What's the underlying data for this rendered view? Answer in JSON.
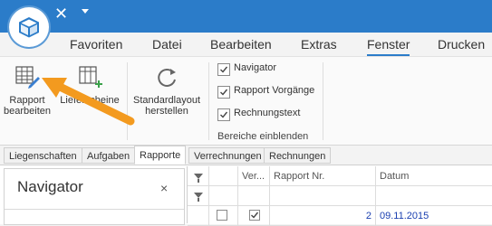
{
  "menu": [
    "Favoriten",
    "Datei",
    "Bearbeiten",
    "Extras",
    "Fenster",
    "Drucken"
  ],
  "active_menu_index": 4,
  "ribbon": {
    "rapport_bearbeiten": [
      "Rapport",
      "bearbeiten"
    ],
    "lieferscheine_partial": "Lieferscheine",
    "standardlayout": [
      "Standardlayout",
      "herstellen"
    ],
    "checkboxes": [
      {
        "label": "Navigator",
        "checked": true
      },
      {
        "label": "Rapport Vorgänge",
        "checked": true
      },
      {
        "label": "Rechnungstext",
        "checked": true
      }
    ],
    "group_label": "Bereiche einblenden"
  },
  "tabs": [
    "Liegenschaften",
    "Aufgaben",
    "Rapporte",
    "Verrechnungen",
    "Rechnungen"
  ],
  "active_tab_index": 2,
  "navigator": {
    "title": "Navigator",
    "close": "×"
  },
  "grid": {
    "headers": [
      "Ver...",
      "Rapport Nr.",
      "Datum"
    ],
    "rows": [
      {
        "rapport_nr": "2",
        "datum": "09.11.2015",
        "ver_checked": true
      }
    ]
  },
  "colors": {
    "accent": "#2b7cc9",
    "arrow": "#f39a1f",
    "link": "#1a3fb0"
  }
}
